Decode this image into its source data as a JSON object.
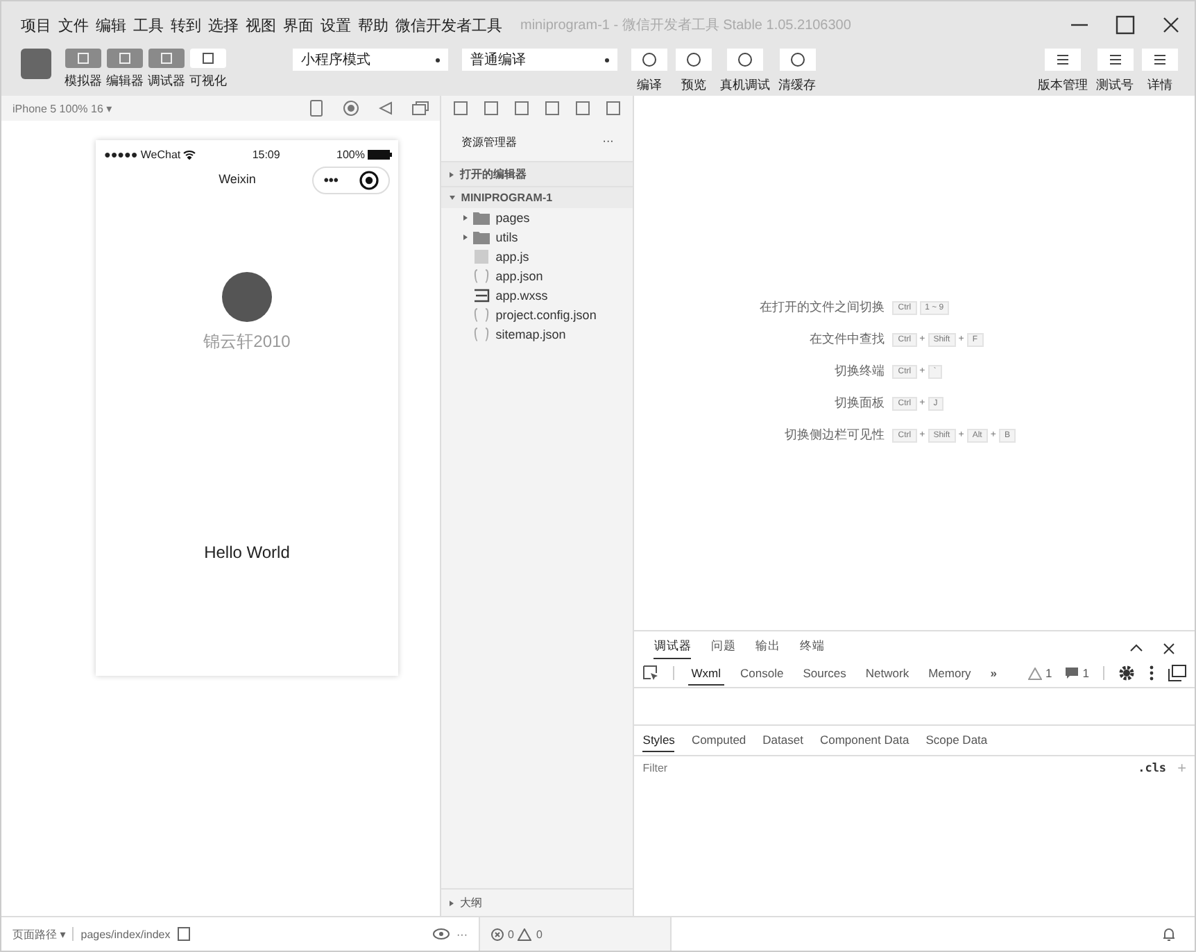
{
  "menu": {
    "items": [
      "项目",
      "文件",
      "编辑",
      "工具",
      "转到",
      "选择",
      "视图",
      "界面",
      "设置",
      "帮助",
      "微信开发者工具"
    ],
    "title": "miniprogram-1 - 微信开发者工具 Stable 1.05.2106300"
  },
  "toolbar": {
    "views": [
      {
        "label": "模拟器",
        "selected": true
      },
      {
        "label": "编辑器",
        "selected": true
      },
      {
        "label": "调试器",
        "selected": true
      },
      {
        "label": "可视化",
        "selected": false
      }
    ],
    "mode_select": "小程序模式",
    "compile_select": "普通编译",
    "actions": [
      "编译",
      "预览",
      "真机调试",
      "清缓存"
    ],
    "right_actions": [
      "版本管理",
      "测试号",
      "详情"
    ]
  },
  "simulator": {
    "device": "iPhone 5 100% 16 ▾",
    "phone": {
      "carrier": "●●●●● WeChat",
      "time": "15:09",
      "battery": "100%",
      "nav_title": "Weixin",
      "capsule_menu": "•••",
      "nickname": "锦云轩2010",
      "content": "Hello World"
    }
  },
  "explorer": {
    "title": "资源管理器",
    "more": "···",
    "sections": [
      {
        "label": "打开的编辑器",
        "expanded": false
      },
      {
        "label": "MINIPROGRAM-1",
        "expanded": true
      }
    ],
    "files": [
      {
        "name": "pages",
        "kind": "folder",
        "expanded": false
      },
      {
        "name": "utils",
        "kind": "folder",
        "expanded": false
      },
      {
        "name": "app.js",
        "kind": "js"
      },
      {
        "name": "app.json",
        "kind": "json"
      },
      {
        "name": "app.wxss",
        "kind": "wxss"
      },
      {
        "name": "project.config.json",
        "kind": "json"
      },
      {
        "name": "sitemap.json",
        "kind": "json"
      }
    ],
    "outline": "大纲",
    "problems": [
      "0",
      "0"
    ]
  },
  "editor": {
    "shortcuts": [
      {
        "label": "在打开的文件之间切换",
        "keys": [
          "Ctrl",
          "1 ~ 9"
        ]
      },
      {
        "label": "在文件中查找",
        "keys": [
          "Ctrl",
          "+",
          "Shift",
          "+",
          "F"
        ]
      },
      {
        "label": "切换终端",
        "keys": [
          "Ctrl",
          "+",
          "`"
        ]
      },
      {
        "label": "切换面板",
        "keys": [
          "Ctrl",
          "+",
          "J"
        ]
      },
      {
        "label": "切换侧边栏可见性",
        "keys": [
          "Ctrl",
          "+",
          "Shift",
          "+",
          "Alt",
          "+",
          "B"
        ]
      }
    ]
  },
  "devtools": {
    "tabs": [
      {
        "label": "调试器",
        "selected": true
      },
      {
        "label": "问题",
        "selected": false
      },
      {
        "label": "输出",
        "selected": false
      },
      {
        "label": "终端",
        "selected": false
      }
    ],
    "panels": [
      {
        "label": "Wxml",
        "selected": true
      },
      {
        "label": "Console",
        "selected": false
      },
      {
        "label": "Sources",
        "selected": false
      },
      {
        "label": "Network",
        "selected": false
      },
      {
        "label": "Memory",
        "selected": false
      }
    ],
    "more": "»",
    "warnings": "1",
    "messages": "1",
    "style_tabs": [
      {
        "label": "Styles",
        "selected": true
      },
      {
        "label": "Computed",
        "selected": false
      },
      {
        "label": "Dataset",
        "selected": false
      },
      {
        "label": "Component Data",
        "selected": false
      },
      {
        "label": "Scope Data",
        "selected": false
      }
    ],
    "filter": {
      "placeholder": "Filter"
    },
    "cls": ".cls",
    "add": "+"
  },
  "status_bar": {
    "page_path": "页面路径 ▾",
    "path": "pages/index/index",
    "more": "···"
  }
}
